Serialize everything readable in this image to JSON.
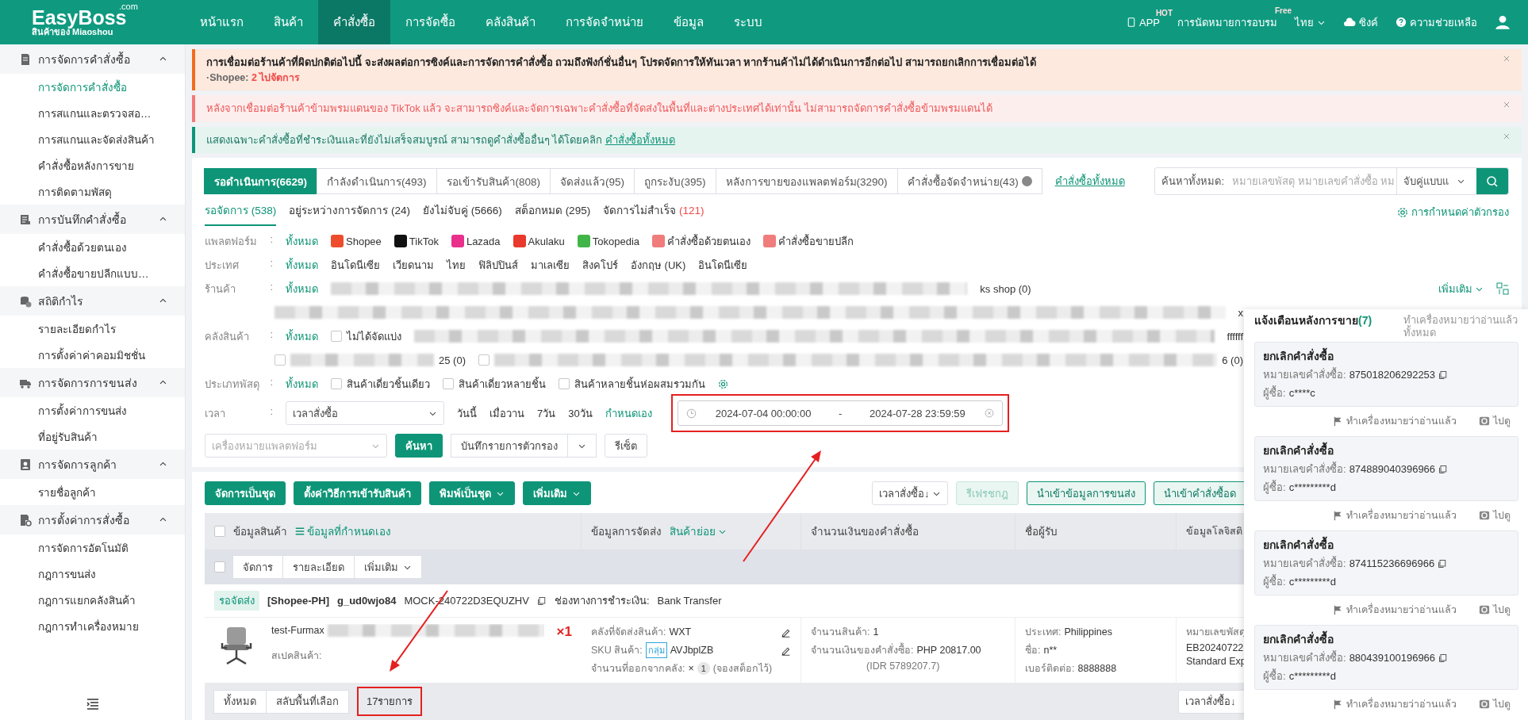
{
  "nav": {
    "logo": "EasyBoss",
    "logo_domain": ".com",
    "logo_sub": "สินค้าของ Miaoshou",
    "menu": [
      {
        "label": "หน้าแรก",
        "selected": false
      },
      {
        "label": "สินค้า",
        "selected": false
      },
      {
        "label": "คำสั่งซื้อ",
        "selected": true
      },
      {
        "label": "การจัดซื้อ",
        "selected": false
      },
      {
        "label": "คลังสินค้า",
        "selected": false
      },
      {
        "label": "การจัดจำหน่าย",
        "selected": false
      },
      {
        "label": "ข้อมูล",
        "selected": false
      },
      {
        "label": "ระบบ",
        "selected": false
      }
    ],
    "app": {
      "label": "APP",
      "badge": "HOT"
    },
    "training": {
      "label": "การนัดหมายการอบรม",
      "badge": "Free"
    },
    "language": "ไทย",
    "sync": "ซิงค์",
    "help": "ความช่วยเหลือ"
  },
  "sidebar": {
    "sections": [
      {
        "title": "การจัดการคำสั่งซื้อ",
        "expanded": true,
        "items": [
          {
            "label": "การจัดการคำสั่งซื้อ",
            "selected": true
          },
          {
            "label": "การสแกนและตรวจสอ…",
            "selected": false
          },
          {
            "label": "การสแกนและจัดส่งสินค้า",
            "selected": false
          },
          {
            "label": "คำสั่งซื้อหลังการขาย",
            "selected": false
          },
          {
            "label": "การติดตามพัสดุ",
            "selected": false
          }
        ]
      },
      {
        "title": "การบันทึกคำสั่งซื้อ",
        "expanded": true,
        "items": [
          {
            "label": "คำสั่งซื้อด้วยตนเอง",
            "selected": false
          },
          {
            "label": "คำสั่งซื้อขายปลีกแบบ…",
            "selected": false
          }
        ]
      },
      {
        "title": "สถิติกำไร",
        "expanded": true,
        "items": [
          {
            "label": "รายละเอียดกำไร",
            "selected": false
          },
          {
            "label": "การตั้งค่าค่าคอมมิชชั่น",
            "selected": false
          }
        ]
      },
      {
        "title": "การจัดการการขนส่ง",
        "expanded": true,
        "items": [
          {
            "label": "การตั้งค่าการขนส่ง",
            "selected": false
          },
          {
            "label": "ที่อยู่รับสินค้า",
            "selected": false
          }
        ]
      },
      {
        "title": "การจัดการลูกค้า",
        "expanded": true,
        "items": [
          {
            "label": "รายชื่อลูกค้า",
            "selected": false
          }
        ]
      },
      {
        "title": "การตั้งค่าการสั่งซื้อ",
        "expanded": true,
        "items": [
          {
            "label": "การจัดการอัตโนมัติ",
            "selected": false
          },
          {
            "label": "กฎการขนส่ง",
            "selected": false
          },
          {
            "label": "กฎการแยกคลังสินค้า",
            "selected": false
          },
          {
            "label": "กฎการทำเครื่องหมาย",
            "selected": false
          }
        ]
      }
    ]
  },
  "notices": [
    {
      "kind": "warning",
      "text": "การเชื่อมต่อร้านค้าที่ผิดปกติต่อไปนี้ จะส่งผลต่อการซิงค์และการจัดการคำสั่งซื้อ ถวมถึงฟังก์ชั่นอื่นๆ โปรดจัดการให้ทันเวลา หากร้านค้าไม่ได้ดำเนินการอีกต่อไป สามารถยกเลิกการเชื่อมต่อได้",
      "sub_prefix": "·Shopee:",
      "sub_count": "2",
      "sub_link": "ไปจัดการ"
    },
    {
      "kind": "error",
      "text": "หลังจากเชื่อมต่อร้านค้าข้ามพรมแดนของ TikTok แล้ว จะสามารถซิงค์และจัดการเฉพาะคำสั่งซื้อที่จัดส่งในพื้นที่และต่างประเทศได้เท่านั้น ไม่สามารถจัดการคำสั่งซื้อข้ามพรมแดนได้"
    },
    {
      "kind": "info",
      "text": "แสดงเฉพาะคำสั่งซื้อที่ชำระเงินและที่ยังไม่เสร็จสมบูรณ์ สามารถดูคำสั่งซื้ออื่นๆ ได้โดยคลิก",
      "link": "คำสั่งซื้อทั้งหมด"
    }
  ],
  "filters": {
    "status_tabs": [
      {
        "label": "รอดำเนินการ(6629)",
        "selected": true
      },
      {
        "label": "กำลังดำเนินการ(493)",
        "selected": false
      },
      {
        "label": "รอเข้ารับสินค้า(808)",
        "selected": false
      },
      {
        "label": "จัดส่งแล้ว(95)",
        "selected": false
      },
      {
        "label": "ถูกระงับ(395)",
        "selected": false
      },
      {
        "label": "หลังการขายของแพลตฟอร์ม(3290)",
        "selected": false
      },
      {
        "label": "คำสั่งซื้อจัดจำหน่าย(43)",
        "selected": false
      }
    ],
    "all_orders_link": "คำสั่งซื้อทั้งหมด",
    "search": {
      "label": "ค้นหาทั้งหมด:",
      "placeholder": "หมายเลขพัสดุ หมายเลขคำสั่งซื้อ หม",
      "match": "จับคู่แบบแ"
    },
    "filter_settings": "การกำหนดค่าตัวกรอง",
    "sub_tabs": [
      {
        "label": "รอจัดการ",
        "count": "(538)",
        "selected": true,
        "warning": false
      },
      {
        "label": "อยู่ระหว่างการจัดการ",
        "count": "(24)",
        "selected": false,
        "warning": false
      },
      {
        "label": "ยังไม่จับคู่",
        "count": "(5666)",
        "selected": false,
        "warning": false
      },
      {
        "label": "สต็อกหมด",
        "count": "(295)",
        "selected": false,
        "warning": false
      },
      {
        "label": "จัดการไม่สำเร็จ",
        "count": "(121)",
        "selected": false,
        "warning": true
      }
    ],
    "platform": {
      "label": "แพลตฟอร์ม",
      "sep": ":",
      "all": "ทั้งหมด",
      "options": [
        {
          "label": "Shopee",
          "color": "#ee4d2d"
        },
        {
          "label": "TikTok",
          "color": "#111111"
        },
        {
          "label": "Lazada",
          "color": "#e8308c"
        },
        {
          "label": "Akulaku",
          "color": "#e8392c"
        },
        {
          "label": "Tokopedia",
          "color": "#42b549"
        },
        {
          "label": "คำสั่งซื้อด้วยตนเอง",
          "color": "#f07c7c"
        },
        {
          "label": "คำสั่งซื้อขายปลีก",
          "color": "#f07c7c"
        }
      ]
    },
    "country": {
      "label": "ประเทศ",
      "sep": ":",
      "all": "ทั้งหมด",
      "options": [
        "อินโดนีเซีย",
        "เวียดนาม",
        "ไทย",
        "ฟิลิปปินส์",
        "มาเลเซีย",
        "สิงคโปร์",
        "อังกฤษ (UK)",
        "อินโดนีเซีย"
      ]
    },
    "shop": {
      "label": "ร้านค้า",
      "sep": ":",
      "all": "ทั้งหมด",
      "visible_shop": "ks shop (0)",
      "fragment": "x",
      "more": "เพิ่มเติม"
    },
    "warehouse": {
      "label": "คลังสินค้า",
      "sep": ":",
      "all": "ทั้งหมด",
      "unassigned": {
        "label": "ไม่ได้จัดแบ่ง",
        "checked": false
      },
      "fragment": "ffffff",
      "options": [
        {
          "label": "25 (0)",
          "checked": false
        },
        {
          "label": "6 (0)",
          "checked": false
        }
      ]
    },
    "parcel_type": {
      "label": "ประเภทพัสดุ",
      "sep": ":",
      "all": "ทั้งหมด",
      "options": [
        {
          "label": "สินค้าเดี่ยวชิ้นเดียว",
          "checked": false
        },
        {
          "label": "สินค้าเดี่ยวหลายชิ้น",
          "checked": false
        },
        {
          "label": "สินค้าหลายชิ้นห่อผสมรวมกัน",
          "checked": false
        }
      ]
    },
    "time": {
      "label": "เวลา",
      "sep": ":",
      "field": "เวลาสั่งซื้อ",
      "quick": [
        {
          "label": "วันนี้",
          "selected": false
        },
        {
          "label": "เมื่อวาน",
          "selected": false
        },
        {
          "label": "7วัน",
          "selected": false
        },
        {
          "label": "30วัน",
          "selected": false
        },
        {
          "label": "กำหนดเอง",
          "selected": true
        }
      ],
      "start": "2024-07-04 00:00:00",
      "range_sep": "-",
      "end": "2024-07-28 23:59:59"
    },
    "platform_mark": {
      "placeholder": "เครื่องหมายแพลตฟอร์ม"
    },
    "search_button": "ค้นหา",
    "save_filter": "บันทึกรายการตัวกรอง",
    "reset": "รีเซ็ต"
  },
  "order_list": {
    "actions": [
      {
        "label": "จัดการเป็นชุด",
        "dropdown": false
      },
      {
        "label": "ตั้งค่าวิธีการเข้ารับสินค้า",
        "dropdown": false
      },
      {
        "label": "พิมพ์เป็นชุด",
        "dropdown": true
      },
      {
        "label": "เพิ่มเติม",
        "dropdown": true
      }
    ],
    "sort": "เวลาสั่งซื้อ↓",
    "right_actions": [
      {
        "label": "รีเฟรชกฎ",
        "disabled": true
      },
      {
        "label": "นำเข้าข้อมูลการขนส่ง",
        "disabled": false
      },
      {
        "label": "นำเข้าคำสั่งซื้อด",
        "disabled": false
      }
    ],
    "columns": {
      "product": "ข้อมูลสินค้า",
      "custom": "ข้อมูลที่กำหนดเอง",
      "shipping": "ข้อมูลการจัดส่ง",
      "sub_items": "สินค้าย่อย",
      "amount": "จำนวนเงินของคำสั่งซื้อ",
      "recipient": "ชื่อผู้รับ",
      "column_5": "ข้อมูลโลจิสติ"
    },
    "header_checkbox": {
      "checked": false
    },
    "row_checkbox": {
      "checked": false
    },
    "row_actions": [
      "จัดการ",
      "รายละเอียด",
      "เพิ่มเติม"
    ],
    "order": {
      "status": "รอจัดส่ง",
      "shop": "[Shopee-PH]",
      "buyer_id": "g_ud0wjo84",
      "order_no": "MOCK-240722D3EQUZHV",
      "payment_label": "ช่องทางการชำระเงิน:",
      "payment": "Bank Transfer",
      "product_name": "test-Furmax",
      "spec_label": "สเปคสินค้า:",
      "qty": "×1",
      "warehouse_label": "คลังที่จัดส่งสินค้า:",
      "warehouse": "WXT",
      "sku_label": "SKU สินค้า:",
      "sku_tag": "กลุ่ม",
      "sku": "AVJbplZB",
      "out_label": "จำนวนที่ออกจากคลัง:",
      "out_x": "×",
      "out_qty": "1",
      "out_note": "(จองสต็อกไว้)",
      "items_label": "จำนวนสินค้า:",
      "items": "1",
      "amount_label": "จำนวนเงินของคำสั่งซื้อ:",
      "amount": "PHP 20817.00",
      "amount_idr": "(IDR 5789207.7)",
      "country_label": "ประเทศ:",
      "country": "Philippines",
      "name_label": "ชื่อ:",
      "name": "n**",
      "phone_label": "เบอร์ติดต่อ:",
      "phone": "8888888",
      "tracking_label": "หมายเลขพัสดุ",
      "tracking": "EB20240722",
      "service": "Standard Exp"
    },
    "footer": {
      "all": "ทั้งหมด",
      "toggle": "สลับพื้นที่เลือก",
      "count": "17รายการ",
      "sort": "เวลาสั่งซื้อ↓"
    }
  },
  "notifications": {
    "title": "แจ้งเตือนหลังการขาย",
    "count": "(7)",
    "mark_all": "ทำเครื่องหมายว่าอ่านแล้วทั้งหมด",
    "items": [
      {
        "title": "ยกเลิกคำสั่งซื้อ",
        "order_label": "หมายเลขคำสั่งซื้อ:",
        "order": "875018206292253",
        "buyer_label": "ผู้ซื้อ:",
        "buyer": "c****c",
        "mark": "ทำเครื่องหมายว่าอ่านแล้ว",
        "view": "ไปดู"
      },
      {
        "title": "ยกเลิกคำสั่งซื้อ",
        "order_label": "หมายเลขคำสั่งซื้อ:",
        "order": "874889040396966",
        "buyer_label": "ผู้ซื้อ:",
        "buyer": "c*********d",
        "mark": "ทำเครื่องหมายว่าอ่านแล้ว",
        "view": "ไปดู"
      },
      {
        "title": "ยกเลิกคำสั่งซื้อ",
        "order_label": "หมายเลขคำสั่งซื้อ:",
        "order": "874115236696966",
        "buyer_label": "ผู้ซื้อ:",
        "buyer": "c*********d",
        "mark": "ทำเครื่องหมายว่าอ่านแล้ว",
        "view": "ไปดู"
      },
      {
        "title": "ยกเลิกคำสั่งซื้อ",
        "order_label": "หมายเลขคำสั่งซื้อ:",
        "order": "880439100196966",
        "buyer_label": "ผู้ซื้อ:",
        "buyer": "c*********d",
        "mark": "ทำเครื่องหมายว่าอ่านแล้ว",
        "view": "ไปดู"
      }
    ]
  }
}
